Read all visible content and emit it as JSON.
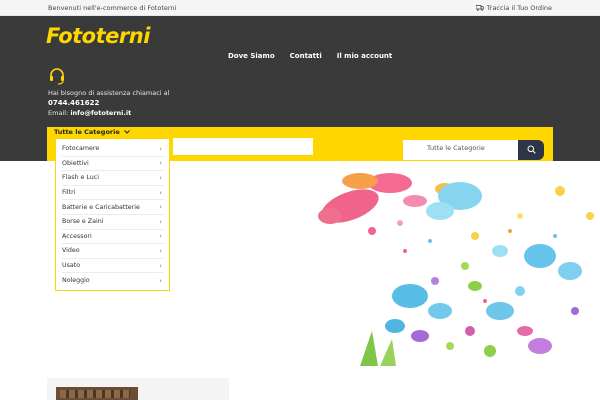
{
  "topbar": {
    "welcome": "Benvenuti nell'e-commerce di Fototerni",
    "track_order": "Traccia il Tuo Ordine"
  },
  "header": {
    "logo": "Fototerni",
    "nav": [
      "Dove Siamo",
      "Contatti",
      "Il mio account"
    ],
    "assist_text": "Hai bisogno di assistenza chiamaci al",
    "phone": "0744.461622",
    "email_label": "Email:",
    "email": "info@fototerni.it"
  },
  "search": {
    "category_toggle": "Tutte le Categorie",
    "select_value": "Tutte le Categorie"
  },
  "categories": [
    "Fotocamere",
    "Obiettivi",
    "Flash e Luci",
    "Filtri",
    "Batterie e Caricabatterie",
    "Borse e Zaini",
    "Accessori",
    "Video",
    "Usato",
    "Noleggio"
  ],
  "colors": {
    "brand_yellow": "#ffd700",
    "header_dark": "#3a3a3a",
    "search_button": "#2e3547"
  }
}
